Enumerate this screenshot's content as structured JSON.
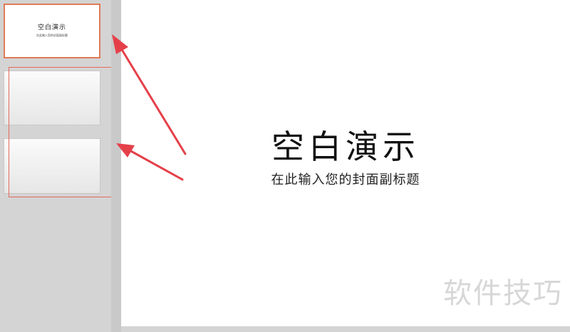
{
  "thumbnails": [
    {
      "title": "空白演示",
      "subtitle": "在此输入您的封面副标题"
    },
    {
      "title": "",
      "subtitle": ""
    },
    {
      "title": "",
      "subtitle": ""
    }
  ],
  "slide": {
    "title": "空白演示",
    "subtitle": "在此输入您的封面副标题"
  },
  "watermark": "软件技巧",
  "colors": {
    "accent_border": "#e07a56",
    "annotation_red": "#e5404a",
    "pane_bg": "#d4d4d4"
  }
}
